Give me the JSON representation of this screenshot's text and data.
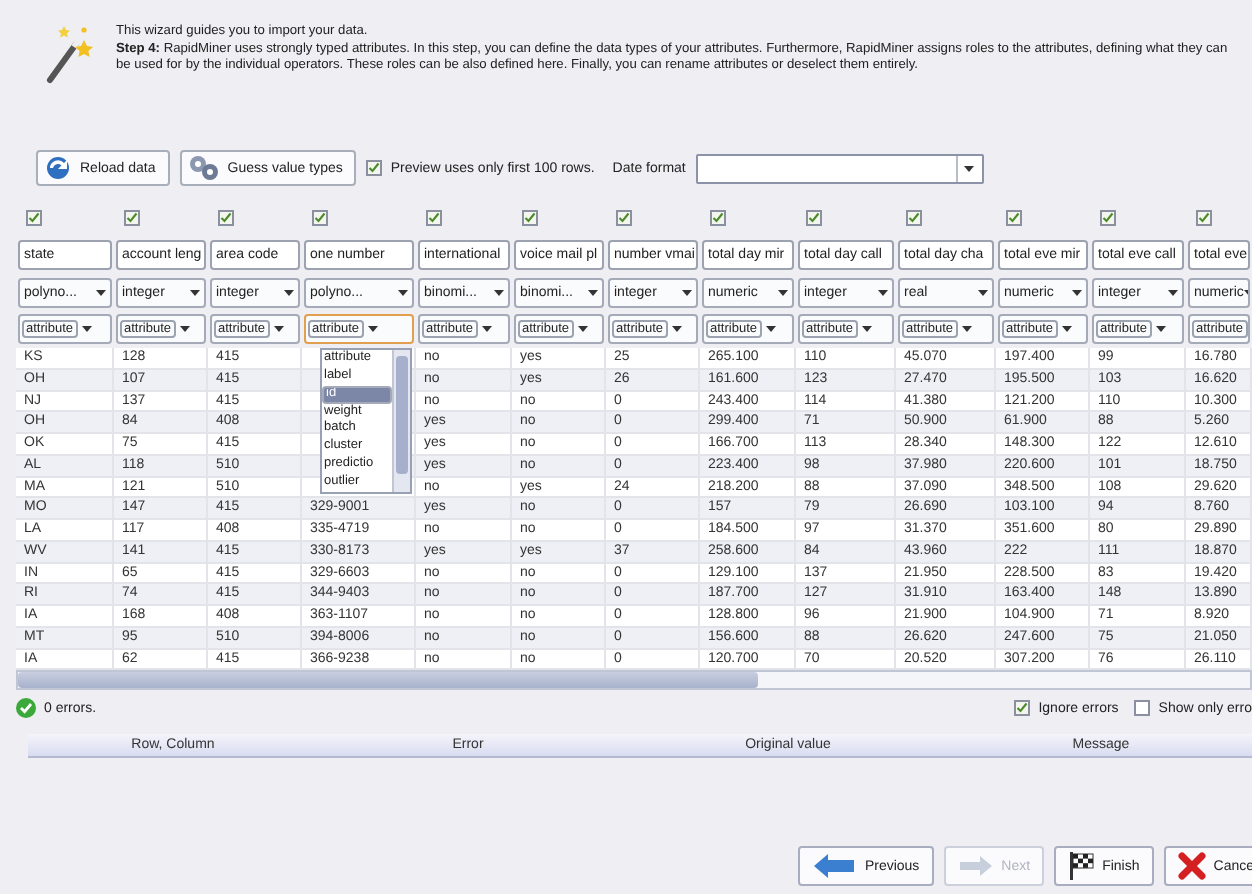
{
  "intro": {
    "line1": "This wizard guides you to import your data.",
    "line2": "**Step 4:** RapidMiner uses strongly typed attributes. In this step, you can define the data types of your attributes. Furthermore, RapidMiner assigns roles to the attributes, defining what they can be used for by the individual operators. These roles can be also defined here. Finally, you can rename attributes or deselect them entirely."
  },
  "toolbar": {
    "reload": "Reload data",
    "guess": "Guess value types",
    "preview": {
      "label": "Preview uses only first 100 rows.",
      "checked": true
    },
    "date_label": "Date format"
  },
  "columns": [
    {
      "checked": true,
      "name": "state",
      "type": "polyno...",
      "role": "attribute"
    },
    {
      "checked": true,
      "name": "account leng",
      "type": "integer",
      "role": "attribute"
    },
    {
      "checked": true,
      "name": "area code",
      "type": "integer",
      "role": "attribute"
    },
    {
      "checked": true,
      "name": "one number",
      "type": "polyno...",
      "role": "attribute",
      "role_menu": {
        "items": [
          {
            "label": "attribute",
            "selected": false
          },
          {
            "label": "label",
            "selected": false
          },
          {
            "label": "id",
            "selected": true
          },
          {
            "label": "weight",
            "selected": false
          },
          {
            "label": "batch",
            "selected": false
          },
          {
            "label": "cluster",
            "selected": false
          },
          {
            "label": "predictio",
            "selected": false
          },
          {
            "label": "outlier",
            "selected": false
          }
        ]
      }
    },
    {
      "checked": true,
      "name": "international",
      "type": "binomi...",
      "role": "attribute"
    },
    {
      "checked": true,
      "name": "voice mail pl",
      "type": "binomi...",
      "role": "attribute"
    },
    {
      "checked": true,
      "name": "number vmai",
      "type": "integer",
      "role": "attribute"
    },
    {
      "checked": true,
      "name": "total day mir",
      "type": "numeric",
      "role": "attribute"
    },
    {
      "checked": true,
      "name": "total day call",
      "type": "integer",
      "role": "attribute"
    },
    {
      "checked": true,
      "name": "total day cha",
      "type": "real",
      "role": "attribute"
    },
    {
      "checked": true,
      "name": "total eve mir",
      "type": "numeric",
      "role": "attribute"
    },
    {
      "checked": true,
      "name": "total eve call",
      "type": "integer",
      "role": "attribute"
    },
    {
      "checked": true,
      "name": "total eve",
      "type": "numeric",
      "role": "attribute"
    }
  ],
  "rows": [
    [
      "KS",
      "128",
      "415",
      null,
      "no",
      "yes",
      "25",
      "265.100",
      "110",
      "45.070",
      "197.400",
      "99",
      "16.780"
    ],
    [
      "OH",
      "107",
      "415",
      null,
      "no",
      "yes",
      "26",
      "161.600",
      "123",
      "27.470",
      "195.500",
      "103",
      "16.620"
    ],
    [
      "NJ",
      "137",
      "415",
      null,
      "no",
      "no",
      "0",
      "243.400",
      "114",
      "41.380",
      "121.200",
      "110",
      "10.300"
    ],
    [
      "OH",
      "84",
      "408",
      null,
      "yes",
      "no",
      "0",
      "299.400",
      "71",
      "50.900",
      "61.900",
      "88",
      "5.260"
    ],
    [
      "OK",
      "75",
      "415",
      null,
      "yes",
      "no",
      "0",
      "166.700",
      "113",
      "28.340",
      "148.300",
      "122",
      "12.610"
    ],
    [
      "AL",
      "118",
      "510",
      null,
      "yes",
      "no",
      "0",
      "223.400",
      "98",
      "37.980",
      "220.600",
      "101",
      "18.750"
    ],
    [
      "MA",
      "121",
      "510",
      null,
      "no",
      "yes",
      "24",
      "218.200",
      "88",
      "37.090",
      "348.500",
      "108",
      "29.620"
    ],
    [
      "MO",
      "147",
      "415",
      "329-9001",
      "yes",
      "no",
      "0",
      "157",
      "79",
      "26.690",
      "103.100",
      "94",
      "8.760"
    ],
    [
      "LA",
      "117",
      "408",
      "335-4719",
      "no",
      "no",
      "0",
      "184.500",
      "97",
      "31.370",
      "351.600",
      "80",
      "29.890"
    ],
    [
      "WV",
      "141",
      "415",
      "330-8173",
      "yes",
      "yes",
      "37",
      "258.600",
      "84",
      "43.960",
      "222",
      "111",
      "18.870"
    ],
    [
      "IN",
      "65",
      "415",
      "329-6603",
      "no",
      "no",
      "0",
      "129.100",
      "137",
      "21.950",
      "228.500",
      "83",
      "19.420"
    ],
    [
      "RI",
      "74",
      "415",
      "344-9403",
      "no",
      "no",
      "0",
      "187.700",
      "127",
      "31.910",
      "163.400",
      "148",
      "13.890"
    ],
    [
      "IA",
      "168",
      "408",
      "363-1107",
      "no",
      "no",
      "0",
      "128.800",
      "96",
      "21.900",
      "104.900",
      "71",
      "8.920"
    ],
    [
      "MT",
      "95",
      "510",
      "394-8006",
      "no",
      "no",
      "0",
      "156.600",
      "88",
      "26.620",
      "247.600",
      "75",
      "21.050"
    ],
    [
      "IA",
      "62",
      "415",
      "366-9238",
      "no",
      "no",
      "0",
      "120.700",
      "70",
      "20.520",
      "307.200",
      "76",
      "26.110"
    ]
  ],
  "status": {
    "errors": "0 errors.",
    "ignore": {
      "label": "Ignore errors",
      "checked": true
    },
    "show_only": {
      "label": "Show only erro",
      "checked": false
    }
  },
  "error_table": {
    "columns": [
      "Row, Column",
      "Error",
      "Original value",
      "Message"
    ]
  },
  "buttons": [
    {
      "kind": "previous",
      "label": "Previous",
      "disabled": false
    },
    {
      "kind": "next",
      "label": "Next",
      "disabled": true
    },
    {
      "kind": "finish",
      "label": "Finish",
      "disabled": false
    },
    {
      "kind": "cancel",
      "label": "Cance",
      "disabled": false
    }
  ]
}
